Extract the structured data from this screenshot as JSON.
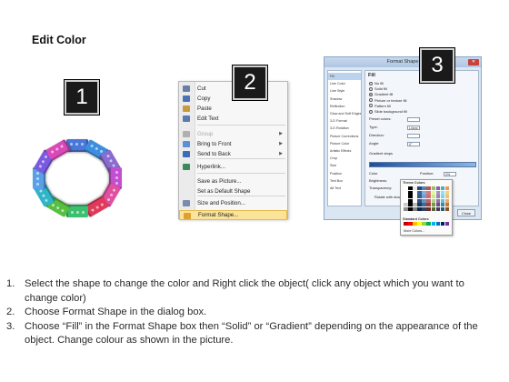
{
  "title": "Edit Color",
  "badges": [
    "1",
    "2",
    "3"
  ],
  "context_menu": {
    "items": [
      {
        "label": "Cut",
        "icon": "scissors-icon",
        "disabled": false,
        "submenu": false
      },
      {
        "label": "Copy",
        "icon": "copy-icon",
        "disabled": false,
        "submenu": false
      },
      {
        "label": "Paste",
        "icon": "paste-icon",
        "disabled": false,
        "submenu": false
      },
      {
        "label": "Edit Text",
        "icon": "edit-text-icon",
        "disabled": false,
        "submenu": false
      },
      {
        "label": "Group",
        "icon": "group-icon",
        "disabled": true,
        "submenu": true
      },
      {
        "label": "Bring to Front",
        "icon": "bring-front-icon",
        "disabled": false,
        "submenu": true
      },
      {
        "label": "Send to Back",
        "icon": "send-back-icon",
        "disabled": false,
        "submenu": true
      },
      {
        "label": "Hyperlink...",
        "icon": "hyperlink-icon",
        "disabled": false,
        "submenu": false
      },
      {
        "label": "Save as Picture...",
        "icon": "",
        "disabled": false,
        "submenu": false
      },
      {
        "label": "Set as Default Shape",
        "icon": "",
        "disabled": false,
        "submenu": false
      },
      {
        "label": "Size and Position...",
        "icon": "size-icon",
        "disabled": false,
        "submenu": false
      },
      {
        "label": "Format Shape...",
        "icon": "format-shape-icon",
        "disabled": false,
        "submenu": false
      }
    ]
  },
  "dialog": {
    "title": "Format Shape",
    "close_label": "Close",
    "sidebar": [
      "Fill",
      "Line Color",
      "Line Style",
      "Shadow",
      "Reflection",
      "Glow and Soft Edges",
      "3-D Format",
      "3-D Rotation",
      "Picture Corrections",
      "Picture Color",
      "Artistic Effects",
      "Crop",
      "Size",
      "Position",
      "Text Box",
      "Alt Text"
    ],
    "fill_heading": "Fill",
    "fill_options": [
      "No fill",
      "Solid fill",
      "Gradient fill",
      "Picture or texture fill",
      "Pattern fill",
      "Slide background fill"
    ],
    "fields": [
      {
        "label": "Preset colors:",
        "value": ""
      },
      {
        "label": "Type:",
        "value": "Linear"
      },
      {
        "label": "Direction:",
        "value": ""
      },
      {
        "label": "Angle:",
        "value": "0°"
      },
      {
        "label": "Gradient stops",
        "value": ""
      },
      {
        "label": "Color",
        "value": ""
      },
      {
        "label": "Position:",
        "value": "0%"
      },
      {
        "label": "Brightness:",
        "value": ""
      },
      {
        "label": "Transparency:",
        "value": ""
      },
      {
        "label": "Rotate with shape",
        "value": ""
      }
    ],
    "theme_colors_label": "Theme Colors",
    "standard_colors_label": "Standard Colors",
    "more_colors_label": "More Colors..."
  },
  "colors": {
    "theme_top": [
      "#ffffff",
      "#000000",
      "#eeece1",
      "#1f497d",
      "#4f81bd",
      "#c0504d",
      "#9bbb59",
      "#8064a2",
      "#4bacc6",
      "#f79646"
    ],
    "standard": [
      "#c00000",
      "#ff0000",
      "#ffc000",
      "#ffff00",
      "#92d050",
      "#00b050",
      "#00b0f0",
      "#0070c0",
      "#002060",
      "#7030a0"
    ],
    "bricks": [
      "#4a78d8",
      "#3c8fe0",
      "#8a6bd0",
      "#c24fd0",
      "#e04fa0",
      "#e03a5a",
      "#3cc070",
      "#58c040",
      "#2fb4c8",
      "#5aa0e8",
      "#7a5ae0",
      "#d94ab8"
    ]
  },
  "instructions": [
    {
      "num": "1.",
      "text": "Select the shape to change the color and Right click the object( click any object which you want to change color)"
    },
    {
      "num": "2.",
      "text": "Choose Format Shape in the dialog box."
    },
    {
      "num": "3.",
      "text": "Choose “Fill” in the Format Shape box then “Solid” or “Gradient” depending on the appearance of the object. Change colour as shown in the picture."
    }
  ]
}
